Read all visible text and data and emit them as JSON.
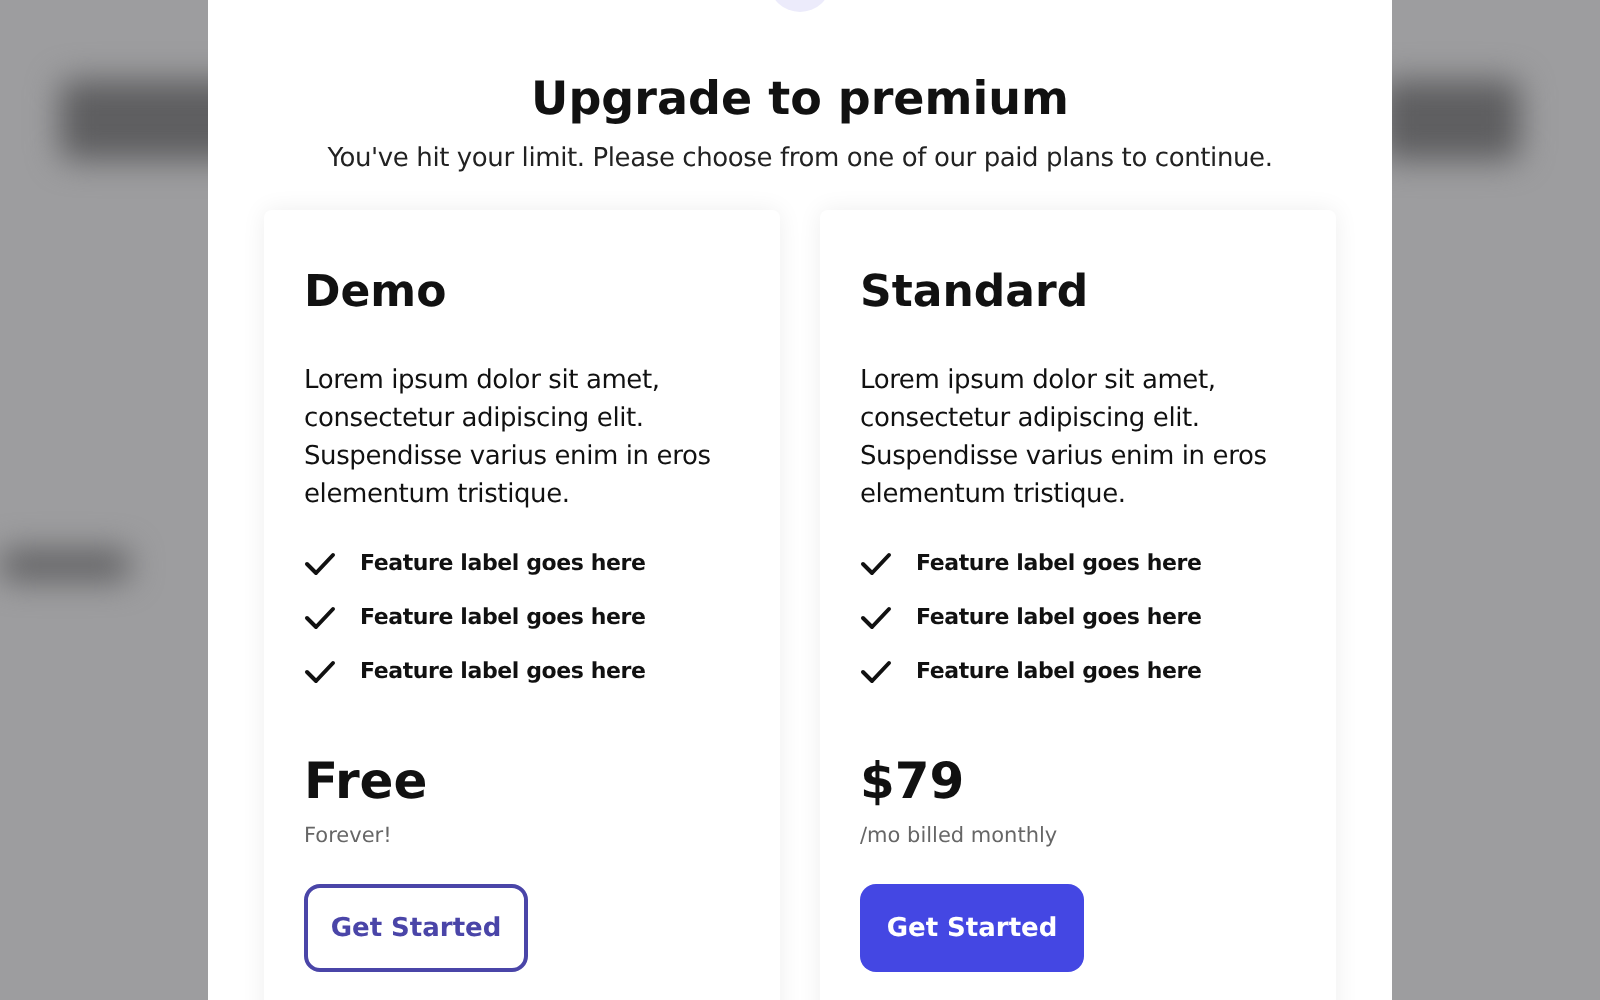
{
  "modal": {
    "title": "Upgrade to premium",
    "subtitle": "You've hit your limit. Please choose from one of our paid plans to continue."
  },
  "plans": [
    {
      "name": "Demo",
      "description": "Lorem ipsum dolor sit amet, consectetur adipiscing elit. Suspendisse varius enim in eros elementum tristique.",
      "features": [
        "Feature label goes here",
        "Feature label goes here",
        "Feature label goes here"
      ],
      "price": "Free",
      "price_note": "Forever!",
      "button": {
        "label": "Get Started",
        "kind": "outline"
      }
    },
    {
      "name": "Standard",
      "description": "Lorem ipsum dolor sit amet, consectetur adipiscing elit. Suspendisse varius enim in eros elementum tristique.",
      "features": [
        "Feature label goes here",
        "Feature label goes here",
        "Feature label goes here"
      ],
      "price": "$79",
      "price_note": "/mo billed monthly",
      "button": {
        "label": "Get Started",
        "kind": "solid"
      }
    }
  ]
}
